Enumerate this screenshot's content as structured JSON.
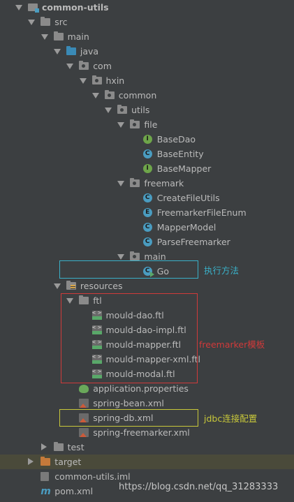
{
  "tree": [
    {
      "depth": 0,
      "arrow": "down",
      "icon": "module-icon",
      "label": "common-utils",
      "bold": true
    },
    {
      "depth": 1,
      "arrow": "down",
      "icon": "folder-icon",
      "label": "src"
    },
    {
      "depth": 2,
      "arrow": "down",
      "icon": "folder-icon",
      "label": "main"
    },
    {
      "depth": 3,
      "arrow": "down",
      "icon": "source-folder-icon",
      "label": "java"
    },
    {
      "depth": 4,
      "arrow": "down",
      "icon": "package-icon",
      "label": "com"
    },
    {
      "depth": 5,
      "arrow": "down",
      "icon": "package-icon",
      "label": "hxin"
    },
    {
      "depth": 6,
      "arrow": "down",
      "icon": "package-icon",
      "label": "common"
    },
    {
      "depth": 7,
      "arrow": "down",
      "icon": "package-icon",
      "label": "utils"
    },
    {
      "depth": 8,
      "arrow": "down",
      "icon": "package-icon",
      "label": "file"
    },
    {
      "depth": 9,
      "arrow": "none",
      "icon": "interface-icon",
      "label": "BaseDao"
    },
    {
      "depth": 9,
      "arrow": "none",
      "icon": "class-icon",
      "label": "BaseEntity"
    },
    {
      "depth": 9,
      "arrow": "none",
      "icon": "interface-icon",
      "label": "BaseMapper"
    },
    {
      "depth": 8,
      "arrow": "down",
      "icon": "package-icon",
      "label": "freemark"
    },
    {
      "depth": 9,
      "arrow": "none",
      "icon": "class-icon",
      "label": "CreateFileUtils"
    },
    {
      "depth": 9,
      "arrow": "none",
      "icon": "enum-icon",
      "label": "FreemarkerFileEnum"
    },
    {
      "depth": 9,
      "arrow": "none",
      "icon": "class-icon",
      "label": "MapperModel"
    },
    {
      "depth": 9,
      "arrow": "none",
      "icon": "class-icon",
      "label": "ParseFreemarker"
    },
    {
      "depth": 8,
      "arrow": "down",
      "icon": "package-icon",
      "label": "main"
    },
    {
      "depth": 9,
      "arrow": "none",
      "icon": "runnable-class-icon",
      "label": "Go"
    },
    {
      "depth": 3,
      "arrow": "down",
      "icon": "resources-folder-icon",
      "label": "resources"
    },
    {
      "depth": 4,
      "arrow": "down",
      "icon": "folder-icon",
      "label": "ftl"
    },
    {
      "depth": 5,
      "arrow": "none",
      "icon": "ftl-file-icon",
      "label": "mould-dao.ftl"
    },
    {
      "depth": 5,
      "arrow": "none",
      "icon": "ftl-file-icon",
      "label": "mould-dao-impl.ftl"
    },
    {
      "depth": 5,
      "arrow": "none",
      "icon": "ftl-file-icon",
      "label": "mould-mapper.ftl"
    },
    {
      "depth": 5,
      "arrow": "none",
      "icon": "ftl-file-icon",
      "label": "mould-mapper-xml.ftl"
    },
    {
      "depth": 5,
      "arrow": "none",
      "icon": "ftl-file-icon",
      "label": "mould-modal.ftl"
    },
    {
      "depth": 4,
      "arrow": "none",
      "icon": "properties-file-icon",
      "label": "application.properties"
    },
    {
      "depth": 4,
      "arrow": "none",
      "icon": "xml-file-icon",
      "label": "spring-bean.xml"
    },
    {
      "depth": 4,
      "arrow": "none",
      "icon": "xml-file-icon",
      "label": "spring-db.xml"
    },
    {
      "depth": 4,
      "arrow": "none",
      "icon": "xml-file-icon",
      "label": "spring-freemarker.xml"
    },
    {
      "depth": 2,
      "arrow": "right",
      "icon": "folder-icon",
      "label": "test"
    },
    {
      "depth": 1,
      "arrow": "right",
      "icon": "excluded-folder-icon",
      "label": "target",
      "selected": true
    },
    {
      "depth": 1,
      "arrow": "none",
      "icon": "iml-file-icon",
      "label": "common-utils.iml"
    },
    {
      "depth": 1,
      "arrow": "none",
      "icon": "maven-pom-icon",
      "label": "pom.xml"
    }
  ],
  "annotations": {
    "go_note": "执行方法",
    "ftl_note": "freemarker模板",
    "db_note": "jdbc连接配置",
    "colors": {
      "go": "#3ab0c8",
      "ftl": "#d03a3a",
      "db": "#c8c83a"
    }
  },
  "watermark": "https://blog.csdn.net/qq_31283333"
}
